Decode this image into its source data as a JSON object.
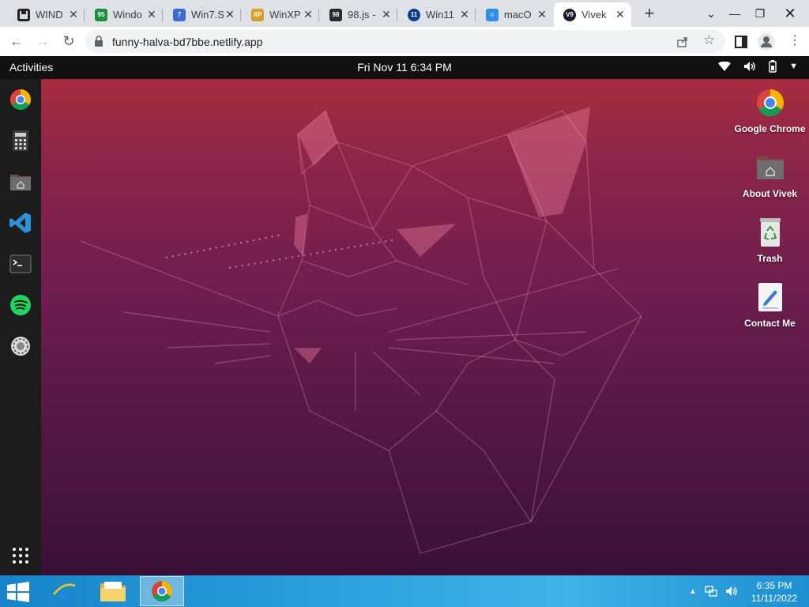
{
  "browser": {
    "tabs": [
      {
        "title": "WIND",
        "favicon": "floppy-icon",
        "color": "#000000"
      },
      {
        "title": "Windo",
        "favicon": "win95-icon",
        "color": "#1f8f3f"
      },
      {
        "title": "Win7.S",
        "favicon": "win7-icon",
        "color": "#3a6bd6"
      },
      {
        "title": "WinXP",
        "favicon": "winxp-icon",
        "color": "#d8a024"
      },
      {
        "title": "98.js -",
        "favicon": "win98-icon",
        "color": "#2a2a2a"
      },
      {
        "title": "Win11",
        "favicon": "win11-icon",
        "color": "#0b3d91"
      },
      {
        "title": "macO",
        "favicon": "finder-icon",
        "color": "#2a8fe6"
      },
      {
        "title": "Vivek",
        "favicon": "v9-icon",
        "color": "#1a1a2e",
        "favicon_text": "V9",
        "active": true
      }
    ],
    "url": "funny-halva-bd7bbe.netlify.app"
  },
  "ubuntu": {
    "activities_label": "Activities",
    "clock": "Fri Nov 11 6:34 PM",
    "dock": [
      "chrome-icon",
      "calculator-icon",
      "home-folder-icon",
      "vscode-icon",
      "terminal-icon",
      "spotify-icon",
      "settings-icon"
    ],
    "desktop_icons": [
      {
        "label": "Google Chrome",
        "icon": "chrome-icon"
      },
      {
        "label": "About Vivek",
        "icon": "home-folder-icon"
      },
      {
        "label": "Trash",
        "icon": "trash-icon"
      },
      {
        "label": "Contact Me",
        "icon": "edit-icon"
      }
    ],
    "accent": "#e95420"
  },
  "taskbar": {
    "time": "6:35 PM",
    "date": "11/11/2022",
    "pinned": [
      "windows-start-icon",
      "internet-explorer-icon",
      "file-explorer-icon",
      "chrome-icon"
    ]
  }
}
